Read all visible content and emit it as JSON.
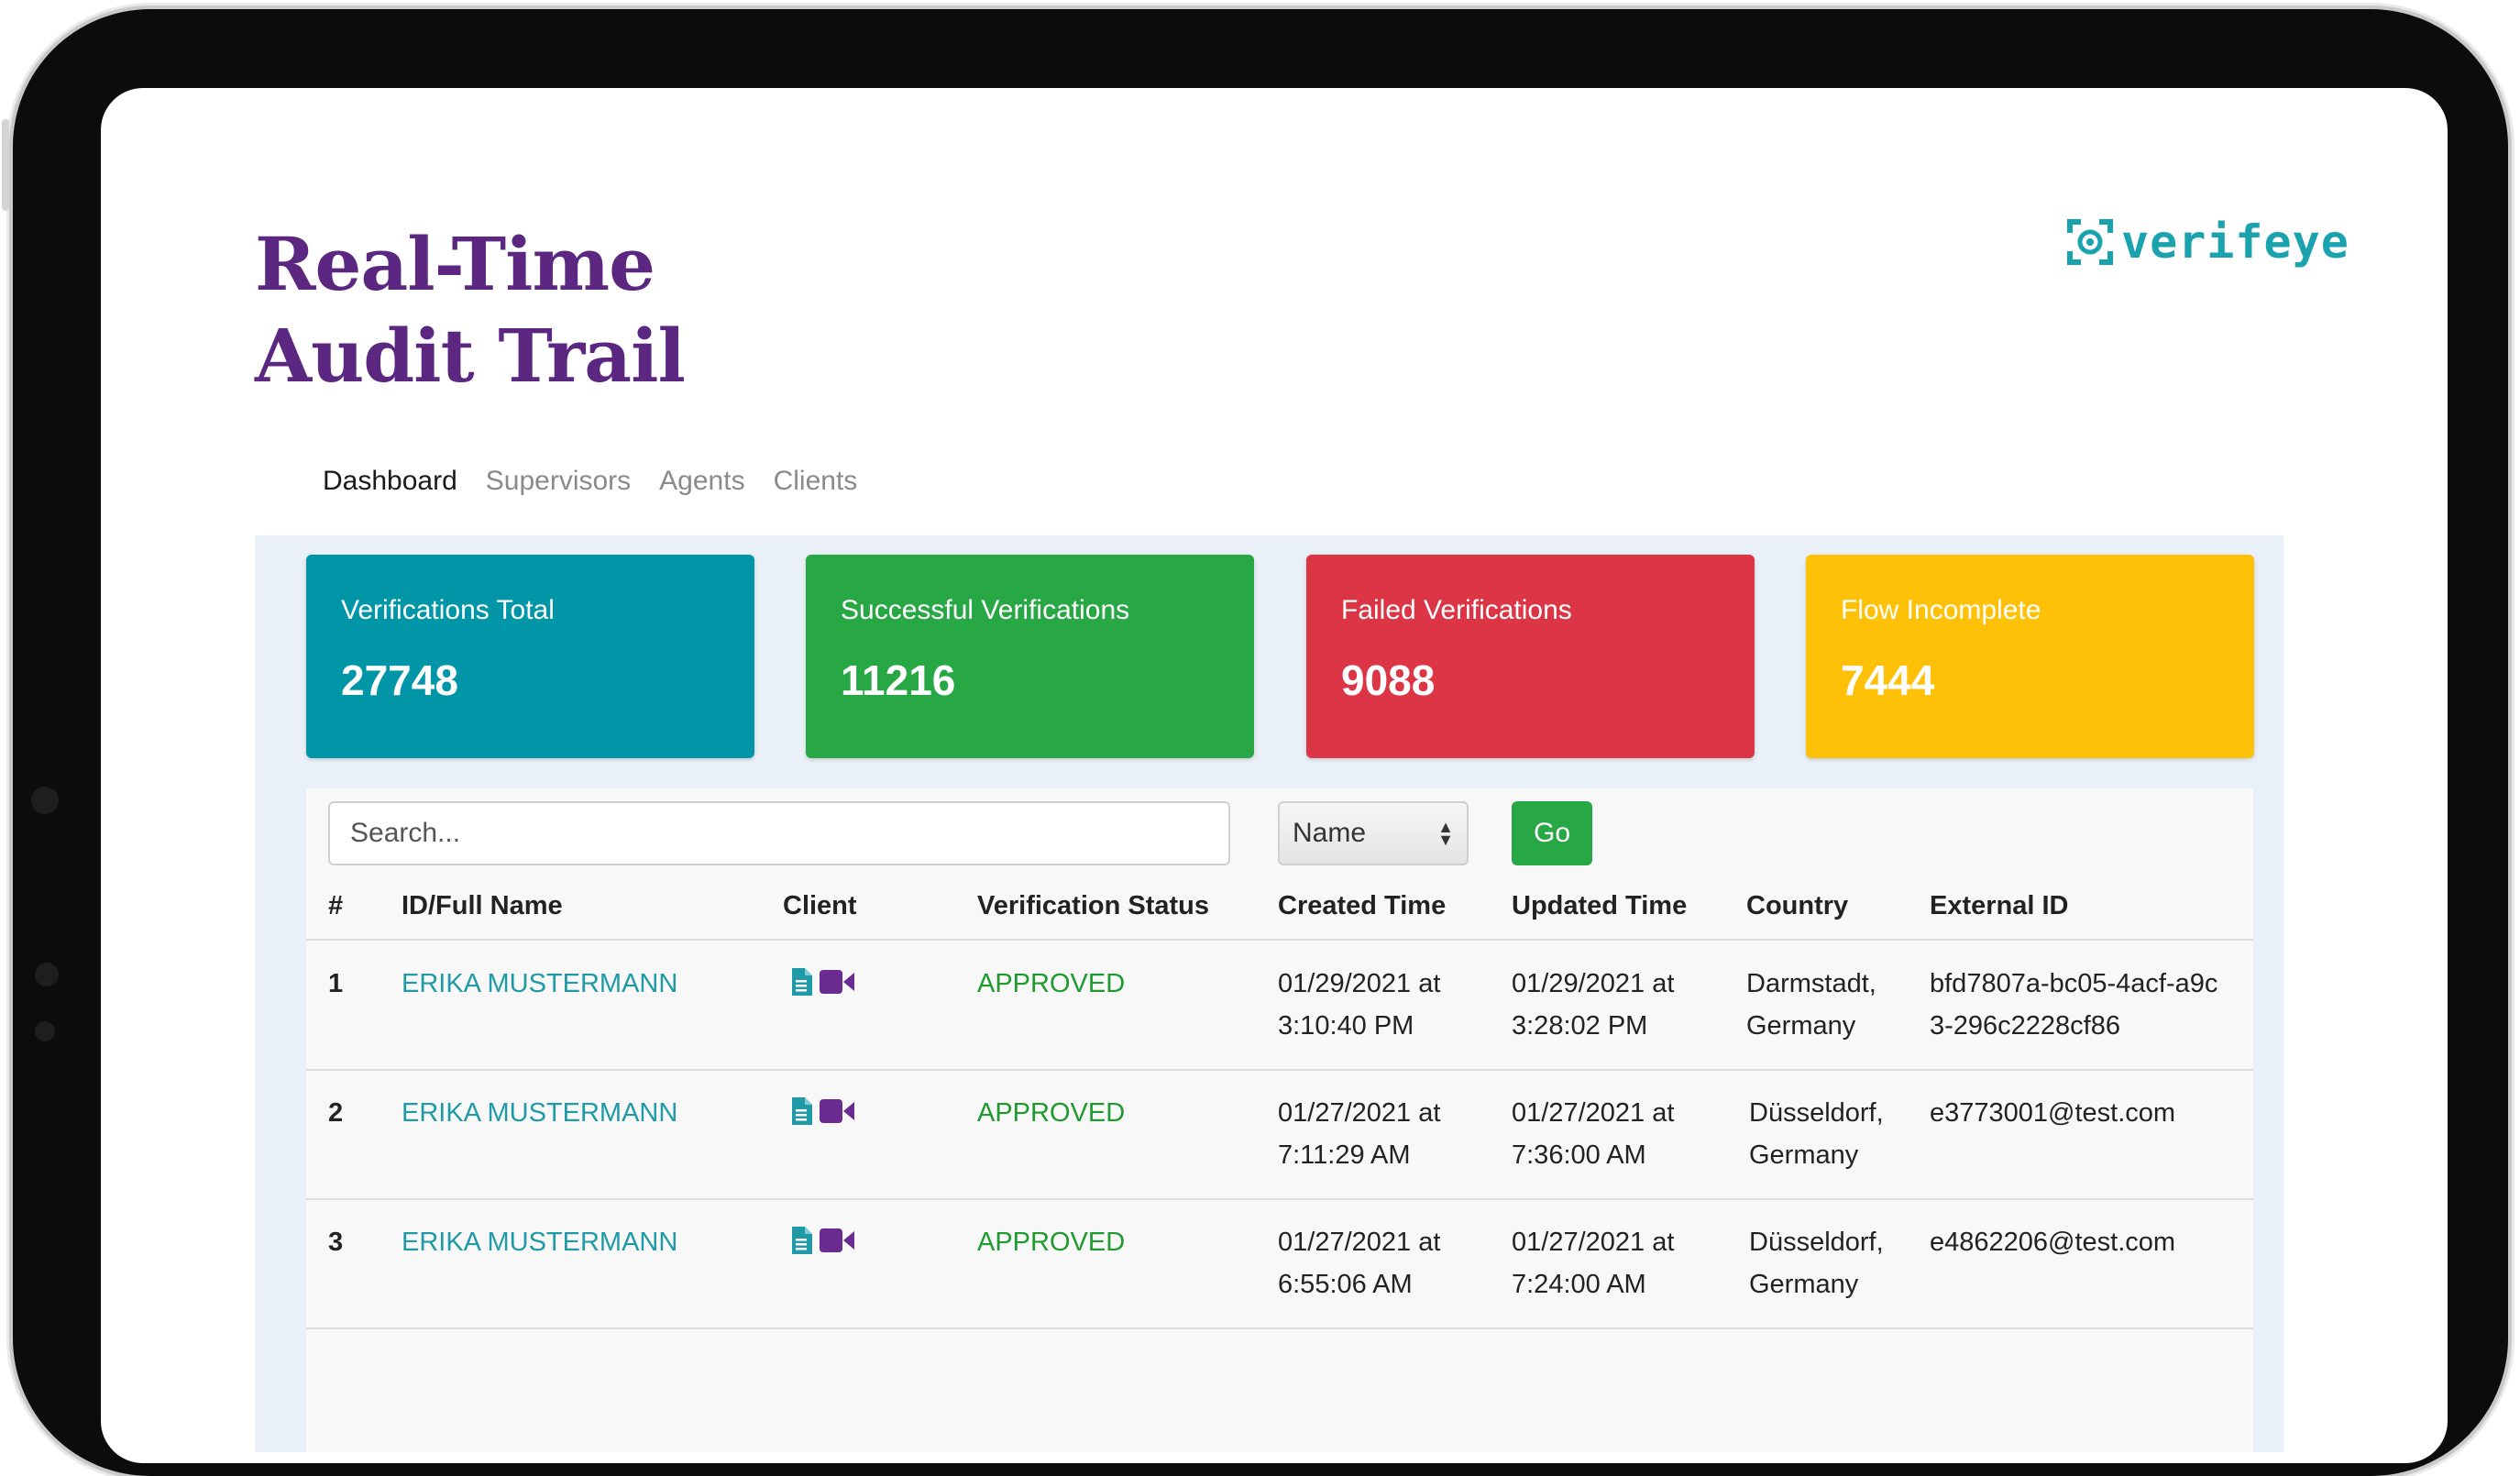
{
  "header": {
    "title_line1": "Real-Time",
    "title_line2": "Audit Trail",
    "logo_text": "verifeye"
  },
  "nav": {
    "items": [
      {
        "label": "Dashboard",
        "active": true
      },
      {
        "label": "Supervisors",
        "active": false
      },
      {
        "label": "Agents",
        "active": false
      },
      {
        "label": "Clients",
        "active": false
      }
    ]
  },
  "stats": [
    {
      "label": "Verifications Total",
      "value": "27748",
      "color": "#0096a8"
    },
    {
      "label": "Successful Verifications",
      "value": "11216",
      "color": "#28a745"
    },
    {
      "label": "Failed Verifications",
      "value": "9088",
      "color": "#dc3545"
    },
    {
      "label": "Flow Incomplete",
      "value": "7444",
      "color": "#ffc107"
    }
  ],
  "search": {
    "placeholder": "Search...",
    "filter_value": "Name",
    "go_label": "Go"
  },
  "table": {
    "columns": [
      "#",
      "ID/Full Name",
      "Client",
      "Verification Status",
      "Created Time",
      "Updated Time",
      "Country",
      "External ID"
    ],
    "rows": [
      {
        "num": "1",
        "name": "ERIKA MUSTERMANN",
        "client_icons": [
          "document-icon",
          "video-icon"
        ],
        "status": "APPROVED",
        "created": "01/29/2021 at 3:10:40 PM",
        "updated": "01/29/2021 at 3:28:02 PM",
        "country": "Darmstadt, Germany",
        "external_id": "bfd7807a-bc05-4acf-a9c3-296c2228cf86"
      },
      {
        "num": "2",
        "name": "ERIKA MUSTERMANN",
        "client_icons": [
          "document-icon",
          "video-icon"
        ],
        "status": "APPROVED",
        "created": "01/27/2021 at 7:11:29 AM",
        "updated": "01/27/2021 at 7:36:00 AM",
        "country": "Düsseldorf, Germany",
        "external_id": "e3773001@test.com"
      },
      {
        "num": "3",
        "name": "ERIKA MUSTERMANN",
        "client_icons": [
          "document-icon",
          "video-icon"
        ],
        "status": "APPROVED",
        "created": "01/27/2021 at 6:55:06 AM",
        "updated": "01/27/2021 at 7:24:00 AM",
        "country": "Düsseldorf, Germany",
        "external_id": "e4862206@test.com"
      }
    ]
  },
  "colors": {
    "title": "#5b2781",
    "logo": "#1aa3ae",
    "link": "#1f9aa6",
    "status_approved": "#1e9a2e",
    "document_icon": "#1f9aa6",
    "video_icon": "#6a2c91"
  }
}
